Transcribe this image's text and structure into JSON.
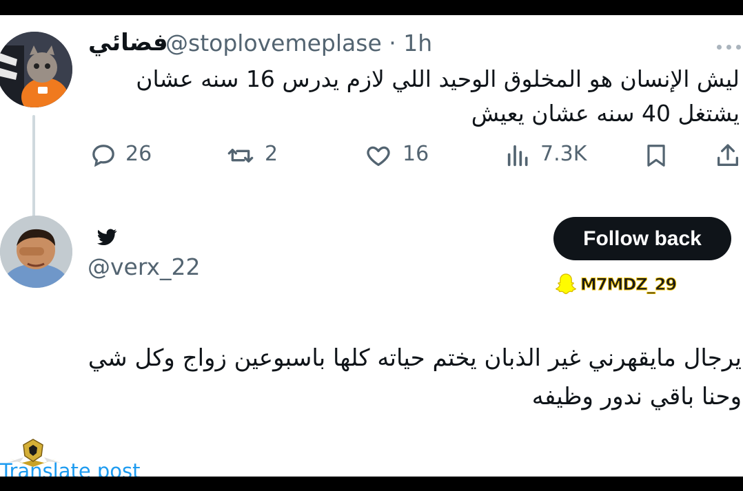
{
  "tweet": {
    "display_name": "فضائي",
    "handle": "@stoplovemeplase",
    "separator": "·",
    "time": "1h",
    "text_lines": [
      "ليش الإنسان هو المخلوق الوحيد اللي لازم يدرس 16 سنه عشان",
      "يشتغل 40 سنه عشان يعيش"
    ],
    "actions": {
      "replies": "26",
      "retweets": "2",
      "likes": "16",
      "views": "7.3K"
    }
  },
  "profile": {
    "handle": "@verx_22",
    "follow_button": "Follow back",
    "snapchat": "M7MDZ_29"
  },
  "reply": {
    "text_lines": [
      "يرجال مايقهرني غير الذبان يختم حياته كلها باسبوعين  زواج وكل شي",
      "وحنا باقي ندور وظيفه"
    ],
    "translate_label": "Translate post"
  },
  "colors": {
    "text": "#0f1419",
    "muted": "#536471",
    "link": "#1d9bf0",
    "button_bg": "#0f1419",
    "snap_yellow": "#fffc00"
  },
  "icons": [
    "more-icon",
    "reply-icon",
    "retweet-icon",
    "like-icon",
    "views-icon",
    "bookmark-icon",
    "share-icon",
    "twitter-bird-icon",
    "snapchat-ghost-icon"
  ]
}
